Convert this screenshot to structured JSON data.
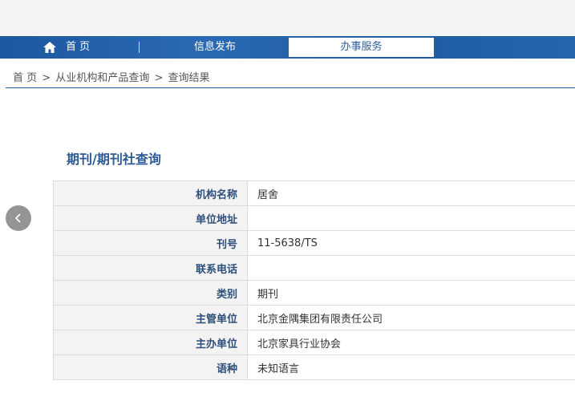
{
  "nav": {
    "home": "首 页",
    "info": "信息发布",
    "service": "办事服务"
  },
  "breadcrumb": {
    "home": "首 页",
    "sep1": ">",
    "category": "从业机构和产品查询",
    "sep2": ">",
    "current": "查询结果"
  },
  "page_title": "期刊/期刊社查询",
  "rows": [
    {
      "label": "机构名称",
      "value": "居舍"
    },
    {
      "label": "单位地址",
      "value": ""
    },
    {
      "label": "刊号",
      "value": "11-5638/TS"
    },
    {
      "label": "联系电话",
      "value": ""
    },
    {
      "label": "类别",
      "value": "期刊"
    },
    {
      "label": "主管单位",
      "value": "北京金隅集团有限责任公司"
    },
    {
      "label": "主办单位",
      "value": "北京家具行业协会"
    },
    {
      "label": "语种",
      "value": "未知语言"
    }
  ],
  "icons": {
    "home": "home-icon",
    "back": "chevron-left-icon"
  },
  "colors": {
    "nav_bg": "#1f5ea6",
    "title": "#2b5a93",
    "label": "#2d4f7a"
  }
}
